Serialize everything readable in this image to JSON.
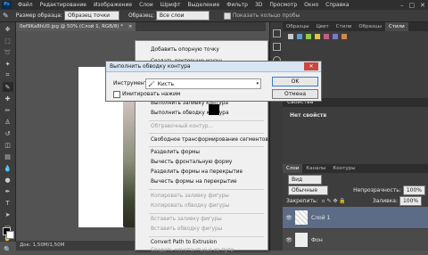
{
  "menubar": {
    "logo": "Ps",
    "items": [
      "Файл",
      "Редактирование",
      "Изображение",
      "Слои",
      "Шрифт",
      "Выделение",
      "Фильтр",
      "3D",
      "Просмотр",
      "Окно",
      "Справка"
    ],
    "window_controls": [
      "–",
      "□",
      "✕"
    ]
  },
  "options": {
    "sample_label": "Размер образца:",
    "sample_value": "Образец точки",
    "samples_label": "Образец:",
    "samples_value": "Все слои",
    "show_ring": "Показать кольцо пробы"
  },
  "document": {
    "tab_title": "0ef9Ka8hU0.jpg @ 50% (Слой 1, RGB/8) *",
    "tab_close": "×",
    "status": "Док: 1,50M/1,50M"
  },
  "panels": {
    "top_tabs": [
      "Образцы",
      "Цвет",
      "Стили",
      "Образцы",
      "Стили"
    ],
    "properties_title": "Свойства",
    "no_properties": "Нет свойств",
    "layers_tabs": [
      "Слои",
      "Каналы",
      "Контуры"
    ],
    "kind_label": "Вид",
    "blend_mode": "Обычные",
    "opacity_label": "Непрозрачность:",
    "opacity_value": "100%",
    "lock_label": "Закрепить:",
    "fill_label": "Заливка:",
    "fill_value": "100%",
    "layers": [
      {
        "name": "Слой 1"
      },
      {
        "name": "Фон"
      }
    ]
  },
  "context_menu": {
    "items": [
      {
        "label": "Добавить опорную точку",
        "disabled": false
      },
      {
        "label": "Создать векторную маску",
        "disabled": false
      },
      {
        "label": "Выполнить заливку контура",
        "disabled": false
      },
      {
        "label": "Выполнить обводку контура",
        "disabled": false
      },
      {
        "label": "Обтравочный контур...",
        "disabled": true
      },
      {
        "label": "Свободное трансформирование сегментов",
        "disabled": false
      },
      {
        "label": "Разделить формы",
        "disabled": false
      },
      {
        "label": "Вычесть фронтальную форму",
        "disabled": false
      },
      {
        "label": "Разделить формы на перекрытие",
        "disabled": false
      },
      {
        "label": "Вычесть формы на перекрытие",
        "disabled": false
      },
      {
        "label": "Копировать заливку фигуры",
        "disabled": true
      },
      {
        "label": "Копировать обводку фигуры",
        "disabled": true
      },
      {
        "label": "Вставить заливку фигуры",
        "disabled": true
      },
      {
        "label": "Вставить обводку фигуры",
        "disabled": true
      },
      {
        "label": "Convert Path to Extrusion",
        "disabled": false
      },
      {
        "label": "Создать константы(ы) из пути",
        "disabled": true
      }
    ]
  },
  "dialog": {
    "title": "Выполнить обводку контура",
    "tool_label": "Инструмент:",
    "tool_value": "Кисть",
    "simulate_pressure": "Имитировать нажим",
    "ok": "OK",
    "cancel": "Отмена"
  },
  "colors": {
    "accent": "#3aa0ff",
    "menu_bg": "#f0f0f0",
    "dialog_title_bg": "#d7e4f2"
  }
}
